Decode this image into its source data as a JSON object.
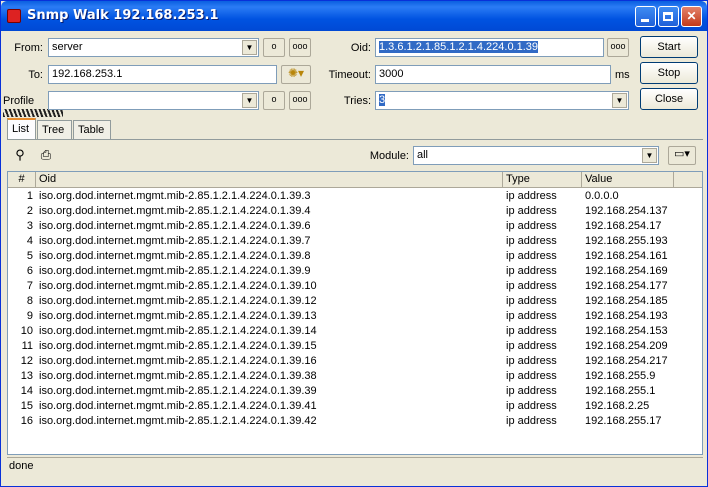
{
  "window": {
    "title": "Snmp Walk 192.168.253.1"
  },
  "form": {
    "from_label": "From:",
    "from_value": "server",
    "to_label": "To:",
    "to_value": "192.168.253.1",
    "profile_label": "Profile",
    "oid_label": "Oid:",
    "oid_value": "1.3.6.1.2.1.85.1.2.1.4.224.0.1.39",
    "timeout_label": "Timeout:",
    "timeout_value": "3000",
    "timeout_unit": "ms",
    "tries_label": "Tries:",
    "tries_value": "3",
    "dots": "ooo",
    "single_dot": "o"
  },
  "buttons": {
    "start": "Start",
    "stop": "Stop",
    "close": "Close"
  },
  "tabs": [
    {
      "label": "List"
    },
    {
      "label": "Tree"
    },
    {
      "label": "Table"
    }
  ],
  "toolbar": {
    "module_label": "Module:",
    "module_value": "all"
  },
  "table": {
    "headers": {
      "num": "#",
      "oid": "Oid",
      "type": "Type",
      "value": "Value"
    },
    "rows": [
      {
        "num": "1",
        "oid": "iso.org.dod.internet.mgmt.mib-2.85.1.2.1.4.224.0.1.39.3",
        "type": "ip address",
        "value": "0.0.0.0"
      },
      {
        "num": "2",
        "oid": "iso.org.dod.internet.mgmt.mib-2.85.1.2.1.4.224.0.1.39.4",
        "type": "ip address",
        "value": "192.168.254.137"
      },
      {
        "num": "3",
        "oid": "iso.org.dod.internet.mgmt.mib-2.85.1.2.1.4.224.0.1.39.6",
        "type": "ip address",
        "value": "192.168.254.17"
      },
      {
        "num": "4",
        "oid": "iso.org.dod.internet.mgmt.mib-2.85.1.2.1.4.224.0.1.39.7",
        "type": "ip address",
        "value": "192.168.255.193"
      },
      {
        "num": "5",
        "oid": "iso.org.dod.internet.mgmt.mib-2.85.1.2.1.4.224.0.1.39.8",
        "type": "ip address",
        "value": "192.168.254.161"
      },
      {
        "num": "6",
        "oid": "iso.org.dod.internet.mgmt.mib-2.85.1.2.1.4.224.0.1.39.9",
        "type": "ip address",
        "value": "192.168.254.169"
      },
      {
        "num": "7",
        "oid": "iso.org.dod.internet.mgmt.mib-2.85.1.2.1.4.224.0.1.39.10",
        "type": "ip address",
        "value": "192.168.254.177"
      },
      {
        "num": "8",
        "oid": "iso.org.dod.internet.mgmt.mib-2.85.1.2.1.4.224.0.1.39.12",
        "type": "ip address",
        "value": "192.168.254.185"
      },
      {
        "num": "9",
        "oid": "iso.org.dod.internet.mgmt.mib-2.85.1.2.1.4.224.0.1.39.13",
        "type": "ip address",
        "value": "192.168.254.193"
      },
      {
        "num": "10",
        "oid": "iso.org.dod.internet.mgmt.mib-2.85.1.2.1.4.224.0.1.39.14",
        "type": "ip address",
        "value": "192.168.254.153"
      },
      {
        "num": "11",
        "oid": "iso.org.dod.internet.mgmt.mib-2.85.1.2.1.4.224.0.1.39.15",
        "type": "ip address",
        "value": "192.168.254.209"
      },
      {
        "num": "12",
        "oid": "iso.org.dod.internet.mgmt.mib-2.85.1.2.1.4.224.0.1.39.16",
        "type": "ip address",
        "value": "192.168.254.217"
      },
      {
        "num": "13",
        "oid": "iso.org.dod.internet.mgmt.mib-2.85.1.2.1.4.224.0.1.39.38",
        "type": "ip address",
        "value": "192.168.255.9"
      },
      {
        "num": "14",
        "oid": "iso.org.dod.internet.mgmt.mib-2.85.1.2.1.4.224.0.1.39.39",
        "type": "ip address",
        "value": "192.168.255.1"
      },
      {
        "num": "15",
        "oid": "iso.org.dod.internet.mgmt.mib-2.85.1.2.1.4.224.0.1.39.41",
        "type": "ip address",
        "value": "192.168.2.25"
      },
      {
        "num": "16",
        "oid": "iso.org.dod.internet.mgmt.mib-2.85.1.2.1.4.224.0.1.39.42",
        "type": "ip address",
        "value": "192.168.255.17"
      }
    ]
  },
  "status": {
    "text": "done"
  }
}
